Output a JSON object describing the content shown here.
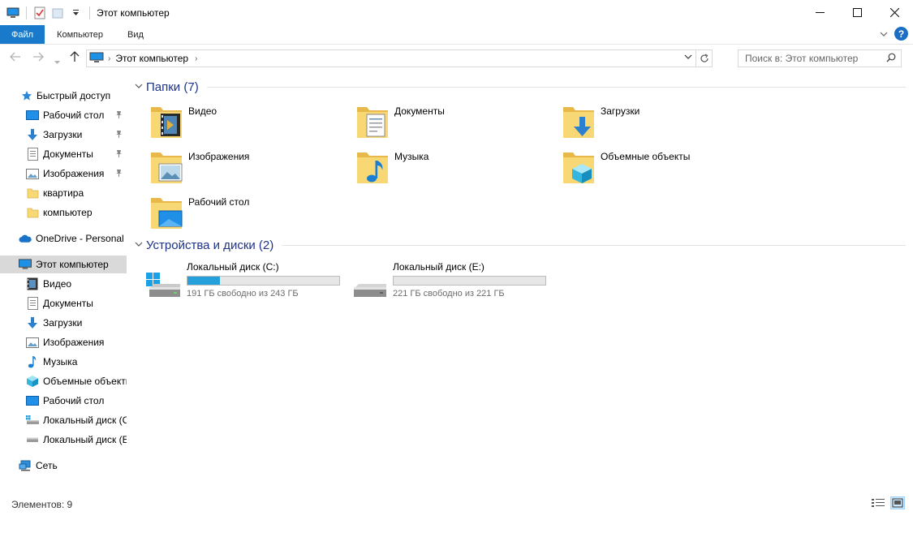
{
  "window": {
    "title": "Этот компьютер",
    "minimize": "—",
    "maximize": "☐",
    "close": "✕"
  },
  "ribbon": {
    "tabs": [
      "Файл",
      "Компьютер",
      "Вид"
    ]
  },
  "address": {
    "path": "Этот компьютер",
    "search_placeholder": "Поиск в: Этот компьютер"
  },
  "nav": {
    "quick_access": "Быстрый доступ",
    "quick_items": [
      {
        "label": "Рабочий стол",
        "icon": "desktop-icon",
        "pinned": true
      },
      {
        "label": "Загрузки",
        "icon": "downloads-icon",
        "pinned": true
      },
      {
        "label": "Документы",
        "icon": "documents-icon",
        "pinned": true
      },
      {
        "label": "Изображения",
        "icon": "pictures-icon",
        "pinned": true
      },
      {
        "label": "квартира",
        "icon": "folder-icon",
        "pinned": false
      },
      {
        "label": "компьютер",
        "icon": "folder-icon",
        "pinned": false
      }
    ],
    "onedrive": "OneDrive - Personal",
    "this_pc": "Этот компьютер",
    "pc_items": [
      {
        "label": "Видео",
        "icon": "video-icon"
      },
      {
        "label": "Документы",
        "icon": "documents-icon"
      },
      {
        "label": "Загрузки",
        "icon": "downloads-icon"
      },
      {
        "label": "Изображения",
        "icon": "pictures-icon"
      },
      {
        "label": "Музыка",
        "icon": "music-icon"
      },
      {
        "label": "Объемные объекты",
        "icon": "3d-objects-icon"
      },
      {
        "label": "Рабочий стол",
        "icon": "desktop-icon"
      },
      {
        "label": "Локальный диск (C:)",
        "icon": "windows-drive-icon"
      },
      {
        "label": "Локальный диск (E:)",
        "icon": "drive-icon"
      }
    ],
    "network": "Сеть"
  },
  "folders": {
    "header": "Папки (7)",
    "items": [
      {
        "label": "Видео",
        "icon": "video-folder-icon"
      },
      {
        "label": "Документы",
        "icon": "documents-folder-icon"
      },
      {
        "label": "Загрузки",
        "icon": "downloads-folder-icon"
      },
      {
        "label": "Изображения",
        "icon": "pictures-folder-icon"
      },
      {
        "label": "Музыка",
        "icon": "music-folder-icon"
      },
      {
        "label": "Объемные объекты",
        "icon": "3d-objects-folder-icon"
      },
      {
        "label": "Рабочий стол",
        "icon": "desktop-folder-icon"
      }
    ]
  },
  "drives": {
    "header": "Устройства и диски (2)",
    "items": [
      {
        "label": "Локальный диск (C:)",
        "info": "191 ГБ свободно из 243 ГБ",
        "used_fraction": 0.214,
        "icon": "windows-drive-icon"
      },
      {
        "label": "Локальный диск (E:)",
        "info": "221 ГБ свободно из 221 ГБ",
        "used_fraction": 0.0,
        "icon": "drive-icon"
      }
    ]
  },
  "status": {
    "count": "Элементов: 9"
  },
  "colors": {
    "accent": "#1979ca",
    "section_header": "#1e3287",
    "drive_fill": "#26a0da",
    "folder": "#f8d775"
  }
}
